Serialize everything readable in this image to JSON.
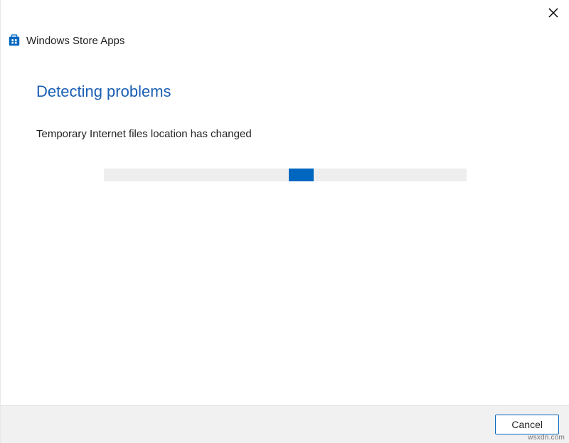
{
  "header": {
    "title": "Windows Store Apps"
  },
  "content": {
    "heading": "Detecting problems",
    "status": "Temporary Internet files location has changed"
  },
  "progress": {
    "chunk_left_percent": 51,
    "chunk_width_percent": 7
  },
  "footer": {
    "cancel_label": "Cancel"
  },
  "watermark": "wsxdn.com",
  "colors": {
    "accent": "#0067c0",
    "heading": "#1a5fb4",
    "track": "#eeeeee",
    "footer_bg": "#f1f1f1"
  }
}
